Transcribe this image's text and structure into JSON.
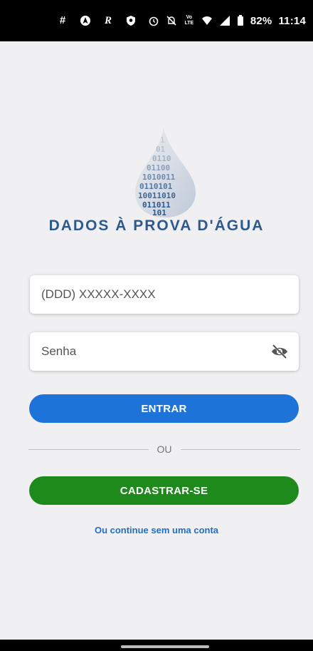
{
  "status_bar": {
    "left_icons": [
      "slack-icon",
      "location-icon",
      "r-icon",
      "shield-icon"
    ],
    "right_icons": [
      "alarm-icon",
      "silent-icon",
      "volte-icon",
      "wifi-icon",
      "signal-icon",
      "battery-icon"
    ],
    "battery": "82%",
    "time": "11:14"
  },
  "brand": {
    "name": "DADOS À PROVA D'ÁGUA",
    "color": "#2d5a8c"
  },
  "login": {
    "phone_placeholder": "(DDD) XXXXX-XXXX",
    "password_placeholder": "Senha",
    "enter_label": "ENTRAR",
    "or_label": "OU",
    "signup_label": "CADASTRAR-SE",
    "guest_label": "Ou continue sem uma conta"
  },
  "colors": {
    "primary": "#1e73d8",
    "secondary": "#1f8a1c",
    "background": "#f0eff1"
  }
}
